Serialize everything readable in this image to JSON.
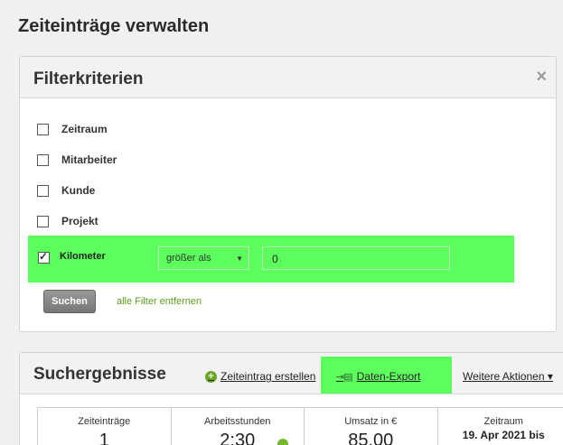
{
  "page": {
    "title": "Zeiteinträge verwalten"
  },
  "filter": {
    "title": "Filterkriterien",
    "close_icon": "×",
    "criteria": [
      {
        "label": "Zeitraum",
        "checked": false
      },
      {
        "label": "Mitarbeiter",
        "checked": false
      },
      {
        "label": "Kunde",
        "checked": false
      },
      {
        "label": "Projekt",
        "checked": false
      }
    ],
    "kilometer": {
      "label": "Kilometer",
      "checked": true,
      "operator": "größer als",
      "value": "0"
    },
    "search_button": "Suchen",
    "clear_link": "alle Filter entfernen"
  },
  "results": {
    "title": "Suchergebnisse",
    "create_link": "Zeiteintrag erstellen",
    "export_link": "Daten-Export",
    "more_actions": "Weitere Aktionen ▾",
    "stats": [
      {
        "label": "Zeiteinträge",
        "value": "1"
      },
      {
        "label": "Arbeitsstunden",
        "value": "2:30"
      },
      {
        "label": "Umsatz in €",
        "value": "85,00"
      },
      {
        "label": "Zeitraum",
        "value": "19. Apr 2021 bis"
      }
    ]
  },
  "colors": {
    "highlight": "#5cff5c",
    "link_green": "#5a9e1c",
    "accent_green": "#6aa624"
  }
}
